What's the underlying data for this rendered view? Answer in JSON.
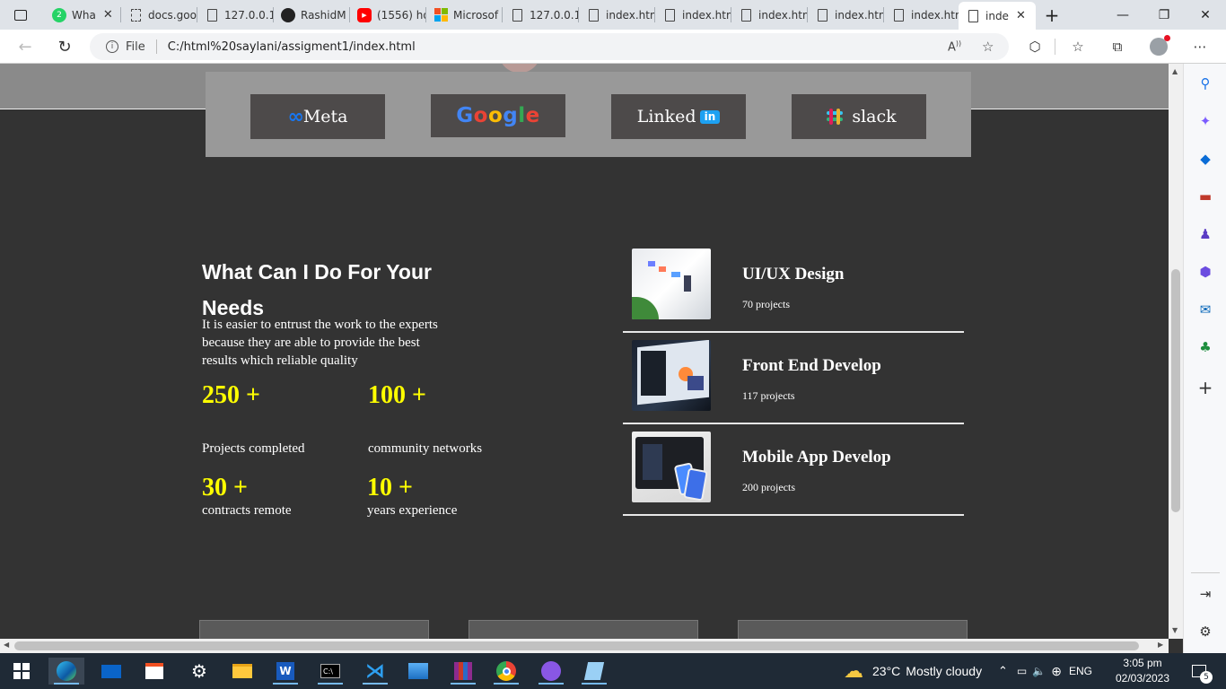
{
  "browser": {
    "tabs": [
      {
        "label": "Wha",
        "icon": "whatsapp-icon",
        "badge": "2"
      },
      {
        "label": "docs.goo",
        "icon": "docs-icon"
      },
      {
        "label": "127.0.0.1",
        "icon": "page-icon"
      },
      {
        "label": "RashidM",
        "icon": "github-icon"
      },
      {
        "label": "(1556) ho",
        "icon": "youtube-icon"
      },
      {
        "label": "Microsof",
        "icon": "microsoft-icon"
      },
      {
        "label": "127.0.0.1",
        "icon": "page-icon"
      },
      {
        "label": "index.htm",
        "icon": "page-icon"
      },
      {
        "label": "index.htm",
        "icon": "page-icon"
      },
      {
        "label": "index.htm",
        "icon": "page-icon"
      },
      {
        "label": "index.htm",
        "icon": "page-icon"
      },
      {
        "label": "index.htm",
        "icon": "page-icon"
      },
      {
        "label": "inde",
        "icon": "page-icon",
        "active": true
      }
    ],
    "address": {
      "scheme_label": "File",
      "url": "C:/html%20saylani/assigment1/index.html"
    }
  },
  "page": {
    "brands": [
      {
        "name": "Meta",
        "logo": "meta-infinity"
      },
      {
        "name": "Google",
        "logo": "google-wordmark"
      },
      {
        "name": "Linked",
        "badge": "in"
      },
      {
        "name": "slack",
        "logo": "slack-hash"
      }
    ],
    "services_section": {
      "heading": "What Can I Do For Your Needs",
      "intro": "It is easier to entrust the work to the experts because they are able to provide the best results which reliable quality",
      "stats": [
        {
          "value": "250 +",
          "label": "Projects completed"
        },
        {
          "value": "100 +",
          "label": "community networks"
        },
        {
          "value": "30 +",
          "label": "contracts remote"
        },
        {
          "value": "10 +",
          "label": "years experience"
        }
      ],
      "services": [
        {
          "title": "UI/UX Design",
          "count": "70 projects"
        },
        {
          "title": "Front End Develop",
          "count": "117 projects"
        },
        {
          "title": "Mobile App Develop",
          "count": "200 projects"
        }
      ]
    }
  },
  "taskbar": {
    "weather": {
      "temp": "23°C",
      "condition": "Mostly cloudy"
    },
    "language": "ENG",
    "time": "3:05 pm",
    "date": "02/03/2023",
    "notifications": "5"
  },
  "colors": {
    "page_bg": "#333333",
    "stat_accent": "#ffff00",
    "brand_box": "#4d4a4a",
    "brand_strip": "#999999"
  }
}
